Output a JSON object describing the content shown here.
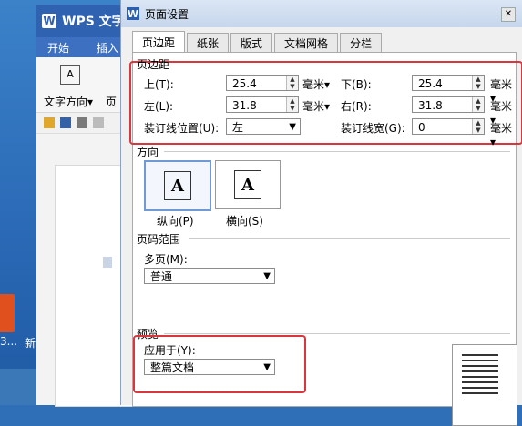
{
  "desktop": {
    "icon_label": "3...",
    "icon_label2": "新"
  },
  "wps": {
    "title": "WPS 文字",
    "menu": [
      "开始",
      "插入"
    ],
    "ribbon": {
      "text_direction": "文字方向",
      "text_direction_caret": "▾",
      "more_label": "页"
    }
  },
  "dialog": {
    "title": "页面设置",
    "tabs": [
      "页边距",
      "纸张",
      "版式",
      "文档网格",
      "分栏"
    ],
    "margins": {
      "group": "页边距",
      "top_label": "上(T):",
      "top_value": "25.4",
      "top_unit": "毫米",
      "bottom_label": "下(B):",
      "bottom_value": "25.4",
      "bottom_unit": "毫米",
      "left_label": "左(L):",
      "left_value": "31.8",
      "left_unit": "毫米",
      "right_label": "右(R):",
      "right_value": "31.8",
      "right_unit": "毫米",
      "gutter_pos_label": "装订线位置(U):",
      "gutter_pos_value": "左",
      "gutter_width_label": "装订线宽(G):",
      "gutter_width_value": "0",
      "gutter_width_unit": "毫米",
      "unit_caret": "▾"
    },
    "orientation": {
      "group": "方向",
      "portrait": "纵向(P)",
      "landscape": "横向(S)",
      "glyph": "A"
    },
    "page_range": {
      "group": "页码范围",
      "multi_label": "多页(M):",
      "multi_value": "普通"
    },
    "preview": {
      "group": "预览",
      "apply_label": "应用于(Y):",
      "apply_value": "整篇文档"
    },
    "select_arrow": "▼",
    "close_glyph": "✕"
  },
  "colors": {
    "highlight": "#d9363e",
    "titlebar": "#2f63b2"
  }
}
